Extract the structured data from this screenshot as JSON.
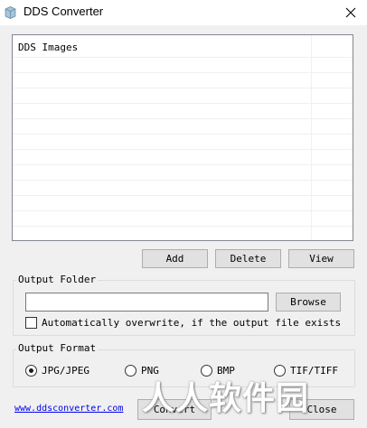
{
  "window": {
    "title": "DDS Converter"
  },
  "list": {
    "header": "DDS Images"
  },
  "list_buttons": {
    "add": "Add",
    "delete": "Delete",
    "view": "View"
  },
  "output_folder": {
    "label": "Output Folder",
    "value": "",
    "browse": "Browse",
    "overwrite_label": "Automatically overwrite, if the output file exists",
    "overwrite_checked": false
  },
  "output_format": {
    "label": "Output Format",
    "options": [
      {
        "label": "JPG/JPEG",
        "selected": true
      },
      {
        "label": "PNG",
        "selected": false
      },
      {
        "label": "BMP",
        "selected": false
      },
      {
        "label": "TIF/TIFF",
        "selected": false
      }
    ]
  },
  "footer": {
    "link": "www.ddsconverter.com",
    "convert": "Convert",
    "close": "Close",
    "watermark": "人人软件园"
  }
}
